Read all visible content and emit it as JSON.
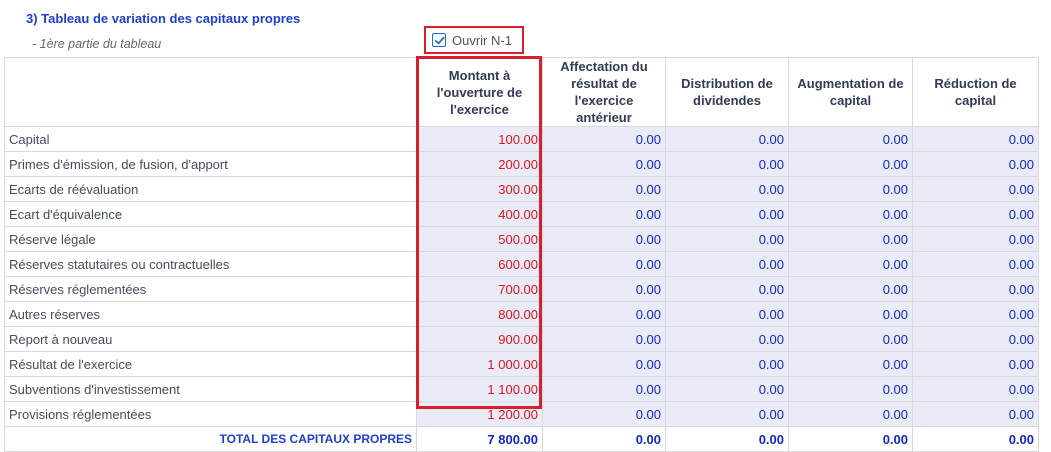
{
  "section_title": "3) Tableau de variation des capitaux propres",
  "subtitle": "- 1ère partie du tableau",
  "ouvrir_checkbox": {
    "label": "Ouvrir N-1",
    "checked": true
  },
  "columns": [
    "",
    "Montant à l'ouverture de l'exercice",
    "Affectation du résultat de l'exercice antérieur",
    "Distribution de dividendes",
    "Augmentation de capital",
    "Réduction de capital"
  ],
  "rows": [
    {
      "label": "Capital",
      "values": [
        "100.00",
        "0.00",
        "0.00",
        "0.00",
        "0.00"
      ]
    },
    {
      "label": "Primes d'émission, de fusion, d'apport",
      "values": [
        "200.00",
        "0.00",
        "0.00",
        "0.00",
        "0.00"
      ]
    },
    {
      "label": "Ecarts de réévaluation",
      "values": [
        "300.00",
        "0.00",
        "0.00",
        "0.00",
        "0.00"
      ]
    },
    {
      "label": "Ecart d'équivalence",
      "values": [
        "400.00",
        "0.00",
        "0.00",
        "0.00",
        "0.00"
      ]
    },
    {
      "label": "Réserve légale",
      "values": [
        "500.00",
        "0.00",
        "0.00",
        "0.00",
        "0.00"
      ]
    },
    {
      "label": "Réserves statutaires ou contractuelles",
      "values": [
        "600.00",
        "0.00",
        "0.00",
        "0.00",
        "0.00"
      ]
    },
    {
      "label": "Réserves réglementées",
      "values": [
        "700.00",
        "0.00",
        "0.00",
        "0.00",
        "0.00"
      ]
    },
    {
      "label": "Autres réserves",
      "values": [
        "800.00",
        "0.00",
        "0.00",
        "0.00",
        "0.00"
      ]
    },
    {
      "label": "Report à nouveau",
      "values": [
        "900.00",
        "0.00",
        "0.00",
        "0.00",
        "0.00"
      ]
    },
    {
      "label": "Résultat de l'exercice",
      "values": [
        "1 000.00",
        "0.00",
        "0.00",
        "0.00",
        "0.00"
      ]
    },
    {
      "label": "Subventions d'investissement",
      "values": [
        "1 100.00",
        "0.00",
        "0.00",
        "0.00",
        "0.00"
      ]
    },
    {
      "label": "Provisions réglementées",
      "values": [
        "1 200.00",
        "0.00",
        "0.00",
        "0.00",
        "0.00"
      ]
    }
  ],
  "total": {
    "label": "TOTAL DES CAPITAUX PROPRES",
    "values": [
      "7 800.00",
      "0.00",
      "0.00",
      "0.00",
      "0.00"
    ]
  },
  "colors": {
    "accent_blue": "#1426c8",
    "highlight_red": "#d4212b",
    "cell_bg": "#e9ecf7"
  }
}
